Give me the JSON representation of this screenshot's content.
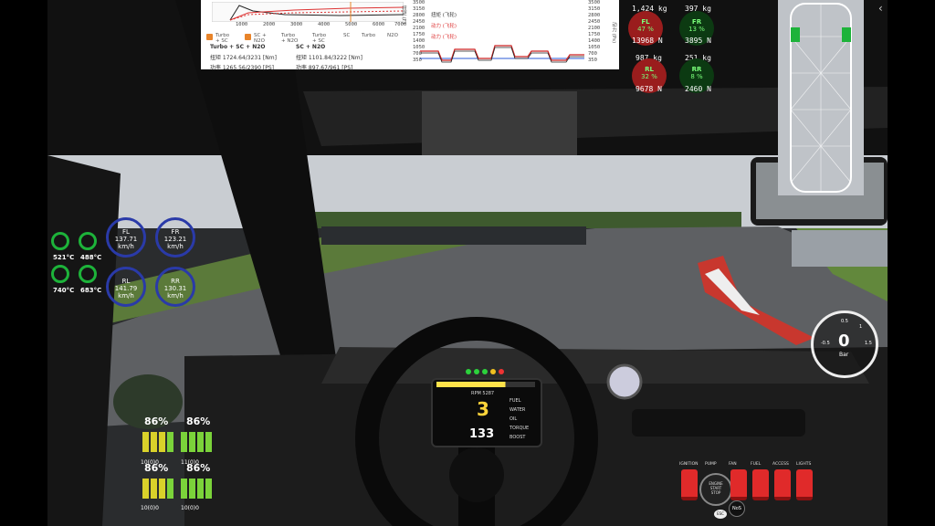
{
  "graph": {
    "rpm_ticks": [
      "1000",
      "2000",
      "3000",
      "4000",
      "5000",
      "6000",
      "7000"
    ],
    "right_ticks": [
      "3500",
      "3150",
      "2800",
      "2450",
      "2100",
      "1750",
      "1400",
      "1050",
      "700",
      "350"
    ],
    "right_ticks_2": [
      "3500",
      "3150",
      "2800",
      "2450",
      "2100",
      "1750",
      "1400",
      "1050",
      "700",
      "350"
    ],
    "legend": [
      {
        "check": true,
        "label": "Turbo\n+ SC"
      },
      {
        "check": true,
        "label": "SC +\nN2O"
      },
      {
        "check": false,
        "label": "Turbo\n+ N2O"
      },
      {
        "check": false,
        "label": "Turbo\n+ SC"
      },
      {
        "check": false,
        "label": "SC"
      },
      {
        "check": false,
        "label": "Turbo"
      },
      {
        "check": false,
        "label": "N2O"
      }
    ],
    "left_header": "Turbo + SC + N2O",
    "right_header": "SC + N2O",
    "left_row1": "扭矩 1724.64/3231 [Nm]",
    "right_row1": "扭矩 1101.84/3222 [Nm]",
    "left_row2": "功率 1265.56/2390 [PS]",
    "right_row2": "功率 897.67/961 [PS]",
    "line_labels": [
      "扭矩 (飞轮)",
      "动力 (飞轮)",
      "动力 (飞轮)"
    ],
    "axis_left": "扭矩 (F)",
    "axis_right": "动力 (Ps)"
  },
  "tires": {
    "fl": {
      "kg": "1,424 kg",
      "name": "FL",
      "pct": "47 %",
      "n": "13968 N"
    },
    "fr": {
      "kg": "397 kg",
      "name": "FR",
      "pct": "13 %",
      "n": "3895 N"
    },
    "rl": {
      "kg": "987 kg",
      "name": "RL",
      "pct": "32 %",
      "n": "9678 N"
    },
    "rr": {
      "kg": "251 kg",
      "name": "RR",
      "pct": "8 %",
      "n": "2460 N"
    }
  },
  "wheel_speeds": {
    "fl": "FL\n137.71 km/h",
    "fr": "FR\n123.21 km/h",
    "rl": "RL\n141.79 km/h",
    "rr": "RR\n130.31 km/h"
  },
  "temps": {
    "t1": "521°C",
    "t2": "488°C",
    "t3": "740°C",
    "t4": "683°C"
  },
  "boost": {
    "value": "0",
    "unit": "Bar",
    "ticks": [
      "0.5",
      "1",
      "1.5",
      "-0.5"
    ]
  },
  "dash": {
    "rpm_label": "RPM 5287",
    "gear": "3",
    "speed": "133",
    "fuel": "FUEL",
    "water": "WATER",
    "oil": "OIL",
    "torque": "TORQUE",
    "boost_lbl": "BOOST"
  },
  "bottom_left": {
    "p1": "86%",
    "p2": "86%",
    "p3": "86%",
    "p4": "86%",
    "l1": "10(0)0",
    "l2": "11(0)0",
    "l3": "10(0)0",
    "l4": "10(0)0"
  },
  "switches": [
    "IGNITION",
    "PUMP",
    "FAN",
    "FUEL",
    "ACCESS",
    "LIGHTS"
  ],
  "start_stop": "ENGINE\nSTART\nSTOP",
  "nos_label": "NoS",
  "esc_label": "ESC",
  "arrow": "‹"
}
